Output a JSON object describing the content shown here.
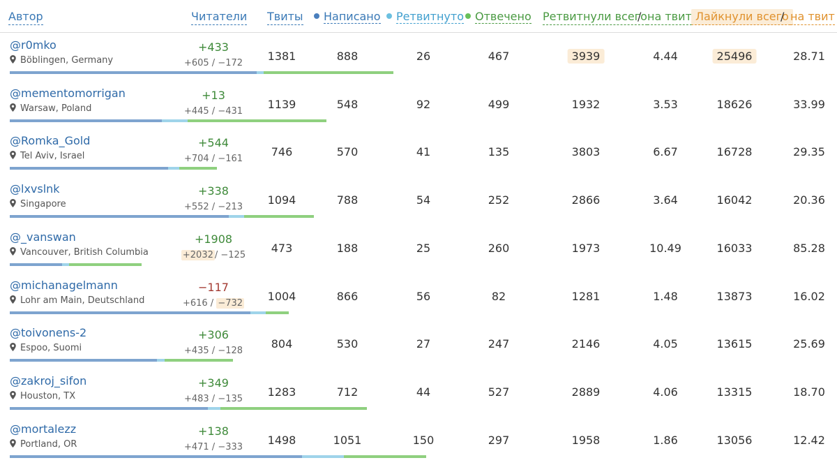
{
  "header": {
    "author": "Автор",
    "readers": "Читатели",
    "tweets": "Твиты",
    "written": "Написано",
    "retweeted": "Ретвитнуто",
    "replied": "Отвечено",
    "rt_total": "Ретвитнули всего",
    "slash": "/",
    "per_tweet": "на твит",
    "likes_total": "Лайкнули всего",
    "per_tweet2": "на твит"
  },
  "colors": {
    "written": "#4a7fbd",
    "retweeted": "#6cc0e0",
    "replied": "#67c05a",
    "likes": "#e0922e"
  },
  "rows": [
    {
      "author": "@r0mko",
      "location": "Böblingen, Germany",
      "net": "+433",
      "gain": "+605",
      "loss": "−172",
      "tweets": "1381",
      "written": "888",
      "retweeted": "26",
      "replied": "467",
      "rt_total": "3939",
      "rt_per": "4.44",
      "likes": "25496",
      "likes_per": "28.71"
    },
    {
      "author": "@mementomorrigan",
      "location": "Warsaw, Poland",
      "net": "+13",
      "gain": "+445",
      "loss": "−431",
      "tweets": "1139",
      "written": "548",
      "retweeted": "92",
      "replied": "499",
      "rt_total": "1932",
      "rt_per": "3.53",
      "likes": "18626",
      "likes_per": "33.99"
    },
    {
      "author": "@Romka_Gold",
      "location": "Tel Aviv, Israel",
      "net": "+544",
      "gain": "+704",
      "loss": "−161",
      "tweets": "746",
      "written": "570",
      "retweeted": "41",
      "replied": "135",
      "rt_total": "3803",
      "rt_per": "6.67",
      "likes": "16728",
      "likes_per": "29.35"
    },
    {
      "author": "@lxvslnk",
      "location": "Singapore",
      "net": "+338",
      "gain": "+552",
      "loss": "−213",
      "tweets": "1094",
      "written": "788",
      "retweeted": "54",
      "replied": "252",
      "rt_total": "2866",
      "rt_per": "3.64",
      "likes": "16042",
      "likes_per": "20.36"
    },
    {
      "author": "@_vanswan",
      "location": "Vancouver, British Columbia",
      "net": "+1908",
      "gain": "+2032",
      "loss": "−125",
      "tweets": "473",
      "written": "188",
      "retweeted": "25",
      "replied": "260",
      "rt_total": "1973",
      "rt_per": "10.49",
      "likes": "16033",
      "likes_per": "85.28"
    },
    {
      "author": "@michanagelmann",
      "location": "Lohr am Main, Deutschland",
      "net": "−117",
      "gain": "+616",
      "loss": "−732",
      "tweets": "1004",
      "written": "866",
      "retweeted": "56",
      "replied": "82",
      "rt_total": "1281",
      "rt_per": "1.48",
      "likes": "13873",
      "likes_per": "16.02"
    },
    {
      "author": "@toivonens-2",
      "location": "Espoo, Suomi",
      "net": "+306",
      "gain": "+435",
      "loss": "−128",
      "tweets": "804",
      "written": "530",
      "retweeted": "27",
      "replied": "247",
      "rt_total": "2146",
      "rt_per": "4.05",
      "likes": "13615",
      "likes_per": "25.69"
    },
    {
      "author": "@zakroj_sifon",
      "location": "Houston, TX",
      "net": "+349",
      "gain": "+483",
      "loss": "−135",
      "tweets": "1283",
      "written": "712",
      "retweeted": "44",
      "replied": "527",
      "rt_total": "2889",
      "rt_per": "4.06",
      "likes": "13315",
      "likes_per": "18.70"
    },
    {
      "author": "@mortalezz",
      "location": "Portland, OR",
      "net": "+138",
      "gain": "+471",
      "loss": "−333",
      "tweets": "1498",
      "written": "1051",
      "retweeted": "150",
      "replied": "297",
      "rt_total": "1958",
      "rt_per": "1.86",
      "likes": "13056",
      "likes_per": "12.42"
    }
  ]
}
